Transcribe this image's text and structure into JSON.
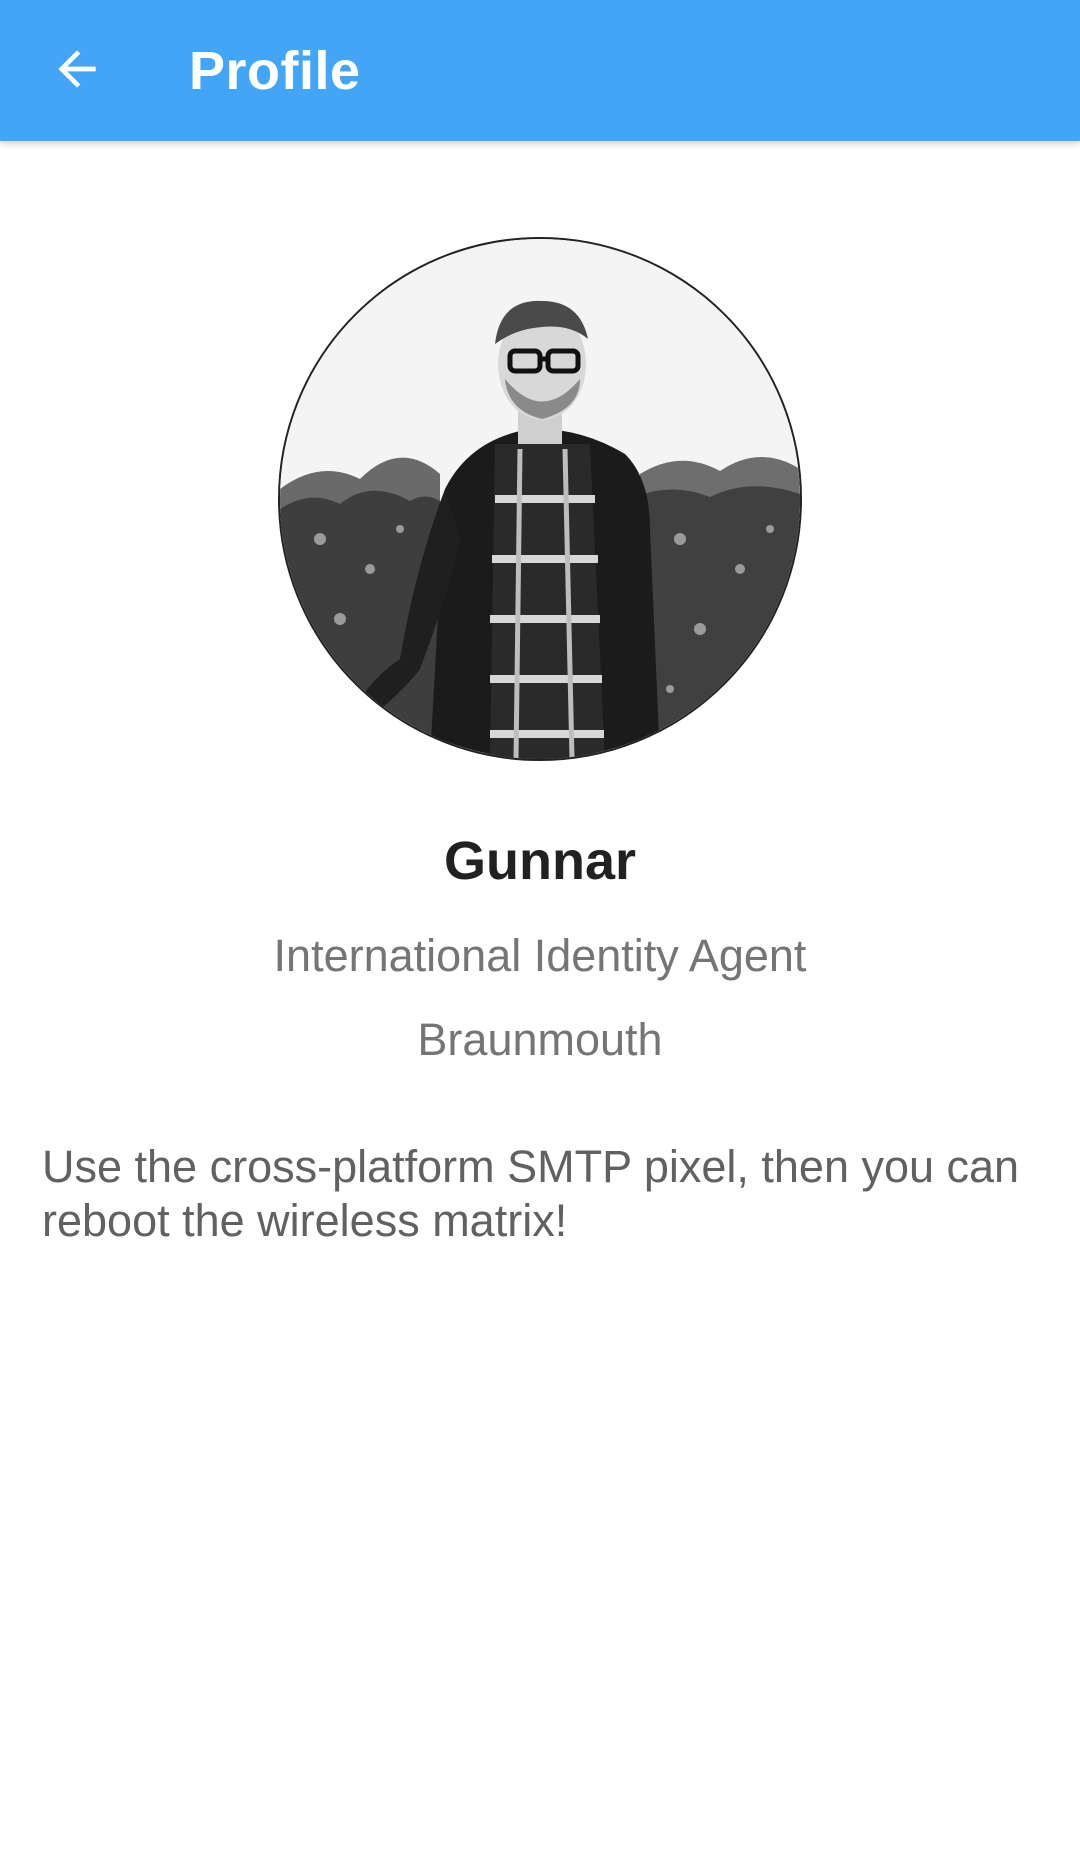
{
  "appbar": {
    "title": "Profile",
    "back_icon": "arrow-back-icon",
    "color": "#42a5f5"
  },
  "profile": {
    "avatar_icon": "avatar-photo",
    "name": "Gunnar",
    "job_title": "International Identity Agent",
    "location": "Braunmouth",
    "bio": "Use the cross-platform SMTP pixel, then you can reboot the wireless matrix!"
  }
}
